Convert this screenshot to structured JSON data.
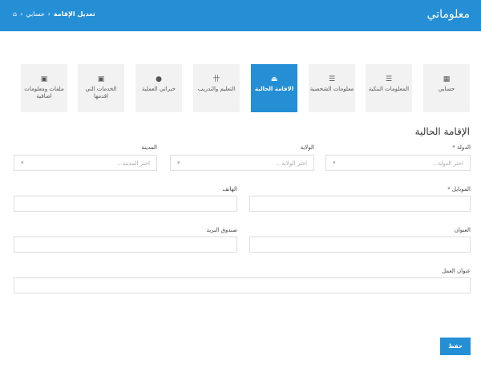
{
  "header": {
    "title": "معلوماتي",
    "breadcrumb": [
      "حسابي",
      "تعديل الإقامة"
    ]
  },
  "tiles": [
    {
      "label": "حسابي",
      "icon": "grid-icon"
    },
    {
      "label": "المعلومات البنكية",
      "icon": "list-icon"
    },
    {
      "label": "معلومات الشخصية",
      "icon": "list-icon"
    },
    {
      "label": "الاقامة الحالية",
      "icon": "upload-icon",
      "active": true
    },
    {
      "label": "التعليم والتدريب",
      "icon": "signpost-icon"
    },
    {
      "label": "خبراتي العملية",
      "icon": "user-icon"
    },
    {
      "label": "الخدمات التي اقدمها",
      "icon": "briefcase-icon"
    },
    {
      "label": "ملفات ومعلومات اضافية",
      "icon": "briefcase-icon"
    }
  ],
  "form": {
    "title": "الإقامة الحالية",
    "country_label": "الدولة *",
    "country_placeholder": "اختر الدولة...",
    "state_label": "الولاية",
    "state_placeholder": "اختر الولاية...",
    "city_label": "المدينة",
    "city_placeholder": "اختر المدينة...",
    "mobile_label": "الموبايل *",
    "phone_label": "الهاتف",
    "address_label": "العنوان",
    "pobox_label": "صندوق البريد",
    "work_address_label": "عنوان العمل",
    "save_label": "حفظ"
  }
}
